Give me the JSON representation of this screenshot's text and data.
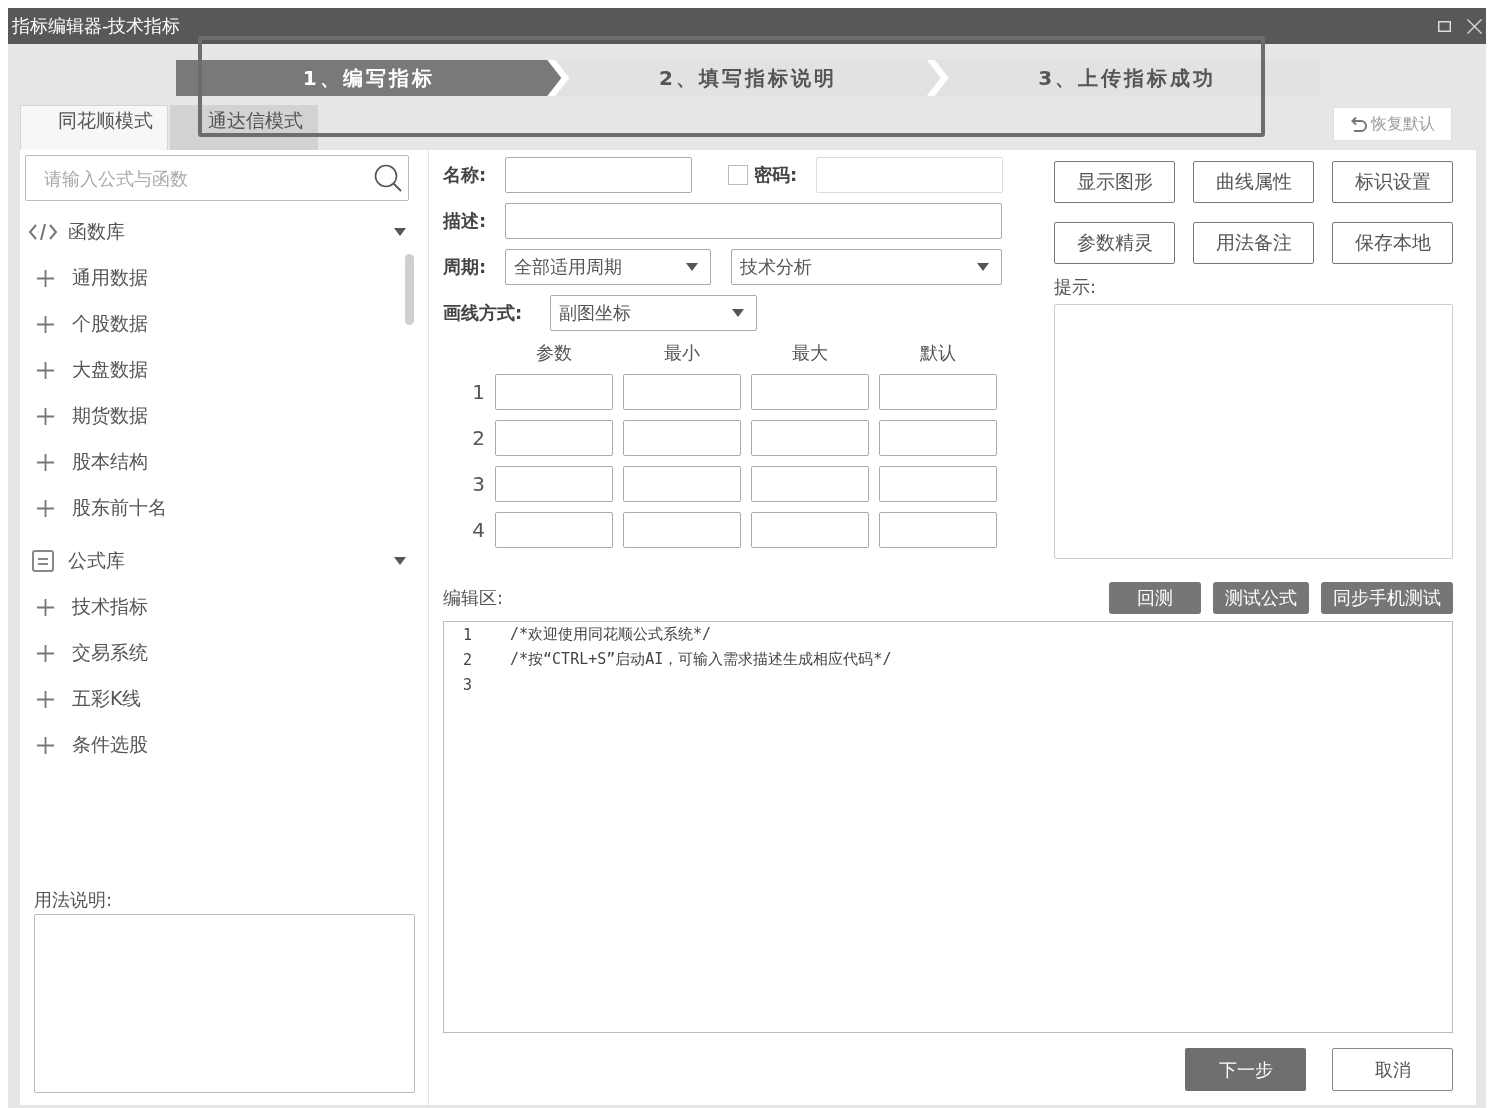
{
  "window": {
    "title": "指标编辑器-技术指标"
  },
  "steps": [
    {
      "label": "1、编写指标",
      "selected": true
    },
    {
      "label": "2、填写指标说明",
      "selected": false
    },
    {
      "label": "3、上传指标成功",
      "selected": false
    }
  ],
  "tabs": [
    {
      "label": "同花顺模式",
      "selected": true
    },
    {
      "label": "通达信模式",
      "selected": false
    }
  ],
  "restore_button": "恢复默认",
  "sidebar": {
    "search": {
      "placeholder": "请输入公式与函数"
    },
    "groups": [
      {
        "kind": "code",
        "label": "函数库",
        "expanded": true,
        "children": [
          {
            "label": "通用数据",
            "expanded": false
          },
          {
            "label": "个股数据",
            "expanded": false
          },
          {
            "label": "大盘数据",
            "expanded": false
          },
          {
            "label": "期货数据",
            "expanded": false
          },
          {
            "label": "股本结构",
            "expanded": false
          },
          {
            "label": "股东前十名",
            "expanded": false
          }
        ]
      },
      {
        "kind": "list",
        "label": "公式库",
        "expanded": true,
        "children": [
          {
            "label": "技术指标",
            "expanded": false
          },
          {
            "label": "交易系统",
            "expanded": false
          },
          {
            "label": "五彩K线",
            "expanded": false
          },
          {
            "label": "条件选股",
            "expanded": false
          }
        ]
      }
    ],
    "usage_label": "用法说明:"
  },
  "form": {
    "name_label": "名称:",
    "password": {
      "label": "密码:",
      "checked": false
    },
    "description_label": "描述:",
    "period": {
      "label": "周期:",
      "value": "全部适用周期"
    },
    "category": {
      "value": "技术分析"
    },
    "draw_mode": {
      "label": "画线方式:",
      "value": "副图坐标"
    }
  },
  "params": {
    "columns": [
      "参数",
      "最小",
      "最大",
      "默认"
    ],
    "rows": [
      "1",
      "2",
      "3",
      "4"
    ]
  },
  "actions": [
    "显示图形",
    "曲线属性",
    "标识设置",
    "参数精灵",
    "用法备注",
    "保存本地"
  ],
  "hint": {
    "label": "提示:"
  },
  "editor": {
    "label": "编辑区:",
    "buttons": [
      "回测",
      "测试公式",
      "同步手机测试"
    ],
    "lines": [
      {
        "number": "1",
        "text": "/*欢迎使用同花顺公式系统*/"
      },
      {
        "number": "2",
        "text": "/*按“CTRL+S”启动AI，可输入需求描述生成相应代码*/"
      },
      {
        "number": "3"
      }
    ]
  },
  "footer": [
    {
      "label": "下一步",
      "kind": "primary"
    },
    {
      "label": "取消",
      "kind": "secondary"
    }
  ]
}
